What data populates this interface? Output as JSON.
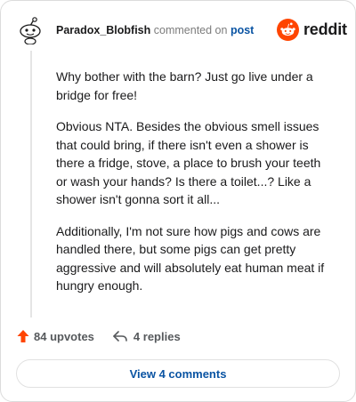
{
  "comment": {
    "author": "Paradox_Blobfish",
    "action_text": "commented on",
    "target_text": "post",
    "paragraphs": [
      "Why bother with the barn? Just go live under a bridge for free!",
      "Obvious NTA. Besides the obvious smell issues that could bring, if there isn't even a shower is there a fridge, stove, a place to brush your teeth or wash your hands? Is there a toilet...? Like a shower isn't gonna sort it all...",
      "Additionally, I'm not sure how pigs and cows are handled there, but some pigs can get pretty aggressive and will absolutely eat human meat if hungry enough."
    ]
  },
  "brand": {
    "name": "reddit",
    "color": "#ff4500"
  },
  "footer": {
    "upvotes_label": "84 upvotes",
    "replies_label": "4 replies",
    "upvote_color": "#ff4500"
  },
  "actions": {
    "view_comments_label": "View 4 comments"
  },
  "icons": {
    "avatar": "snoo-avatar-icon",
    "logo": "reddit-logo-icon",
    "upvote": "upvote-arrow-icon",
    "reply": "reply-arrow-icon"
  }
}
